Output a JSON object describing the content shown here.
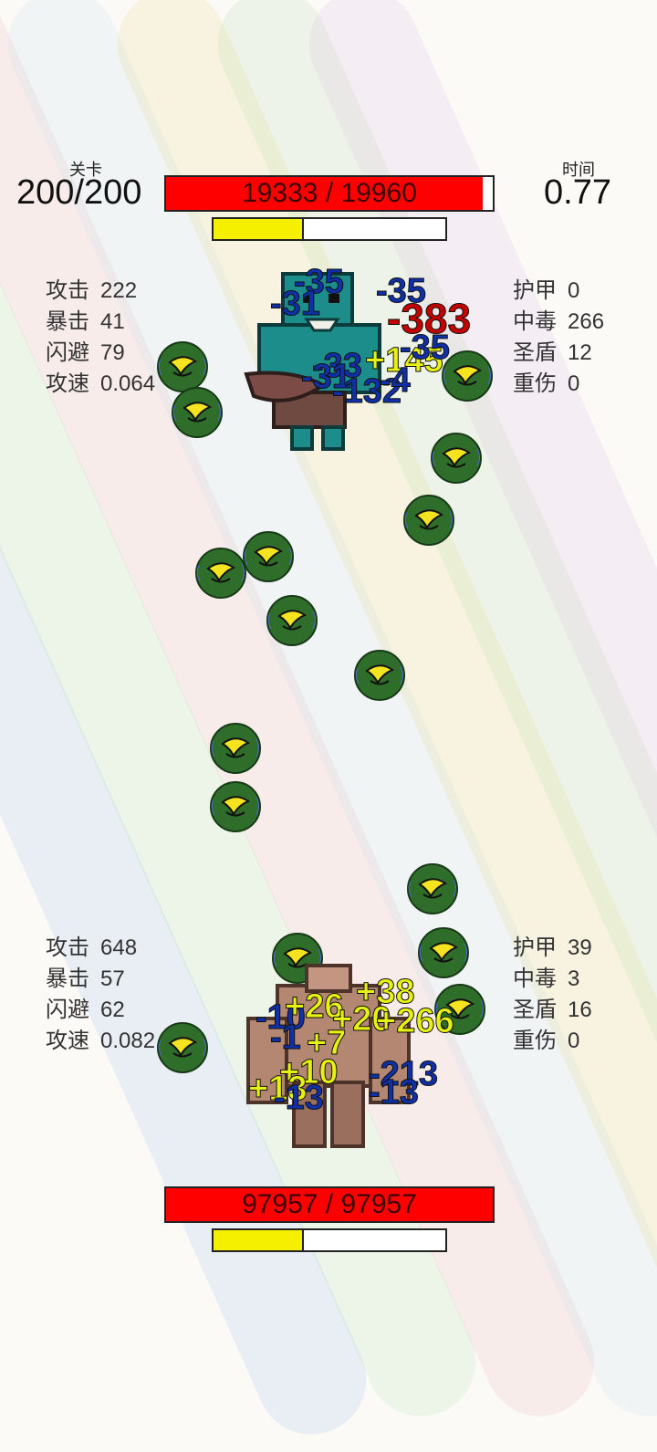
{
  "hud": {
    "level_label": "关卡",
    "level_value": "200/200",
    "time_label": "时间",
    "time_value": "0.77"
  },
  "enemy": {
    "hp_text": "19333 / 19960",
    "hp_current": 19333,
    "hp_max": 19960,
    "energy_fraction": 0.38,
    "left_stats": [
      {
        "label": "攻击",
        "value": "222"
      },
      {
        "label": "暴击",
        "value": "41"
      },
      {
        "label": "闪避",
        "value": "79"
      },
      {
        "label": "攻速",
        "value": "0.064"
      }
    ],
    "right_stats": [
      {
        "label": "护甲",
        "value": "0"
      },
      {
        "label": "中毒",
        "value": "266"
      },
      {
        "label": "圣盾",
        "value": "12"
      },
      {
        "label": "重伤",
        "value": "0"
      }
    ],
    "floating_numbers": [
      "-35",
      "-31",
      "-35",
      "-383",
      "+145",
      "-33",
      "-31",
      "-132",
      "-35",
      "-4"
    ]
  },
  "player": {
    "hp_text": "97957 / 97957",
    "hp_current": 97957,
    "hp_max": 97957,
    "energy_fraction": 0.38,
    "left_stats": [
      {
        "label": "攻击",
        "value": "648"
      },
      {
        "label": "暴击",
        "value": "57"
      },
      {
        "label": "闪避",
        "value": "62"
      },
      {
        "label": "攻速",
        "value": "0.082"
      }
    ],
    "right_stats": [
      {
        "label": "护甲",
        "value": "39"
      },
      {
        "label": "中毒",
        "value": "3"
      },
      {
        "label": "圣盾",
        "value": "16"
      },
      {
        "label": "重伤",
        "value": "0"
      }
    ],
    "floating_numbers": [
      "+38",
      "-10",
      "+26",
      "+20",
      "+266",
      "-1",
      "+7",
      "+10",
      "-213",
      "+13",
      "-13",
      "-13"
    ]
  }
}
